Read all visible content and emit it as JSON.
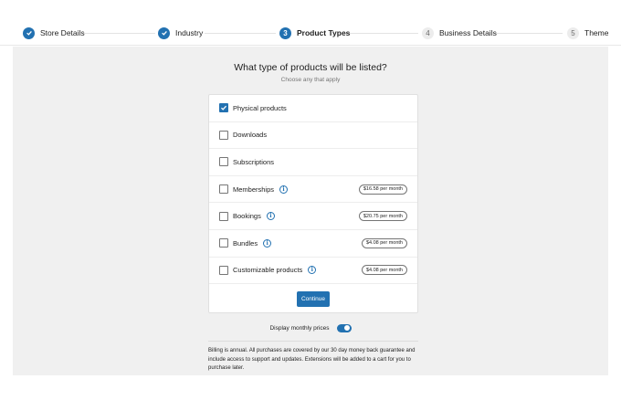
{
  "stepper": {
    "steps": [
      {
        "label": "Store Details",
        "state": "done",
        "badge": "✓"
      },
      {
        "label": "Industry",
        "state": "done",
        "badge": "✓"
      },
      {
        "label": "Product Types",
        "state": "current",
        "badge": "3"
      },
      {
        "label": "Business Details",
        "state": "todo",
        "badge": "4"
      },
      {
        "label": "Theme",
        "state": "todo",
        "badge": "5"
      }
    ]
  },
  "main": {
    "title": "What type of products will be listed?",
    "subtitle": "Choose any that apply",
    "options": [
      {
        "label": "Physical products",
        "checked": true,
        "info": false,
        "price": ""
      },
      {
        "label": "Downloads",
        "checked": false,
        "info": false,
        "price": ""
      },
      {
        "label": "Subscriptions",
        "checked": false,
        "info": false,
        "price": ""
      },
      {
        "label": "Memberships",
        "checked": false,
        "info": true,
        "price": "$16.58 per month"
      },
      {
        "label": "Bookings",
        "checked": false,
        "info": true,
        "price": "$20.75 per month"
      },
      {
        "label": "Bundles",
        "checked": false,
        "info": true,
        "price": "$4.08 per month"
      },
      {
        "label": "Customizable products",
        "checked": false,
        "info": true,
        "price": "$4.08 per month"
      }
    ],
    "continue_label": "Continue",
    "toggle": {
      "label": "Display monthly prices",
      "on": true
    },
    "footnote": "Billing is annual. All purchases are covered by our 30 day money back guarantee and include access to support and updates. Extensions will be added to a cart for you to purchase later."
  },
  "colors": {
    "accent": "#2271b1",
    "background": "#f0f0f0"
  },
  "icons": {
    "check": "check-icon",
    "info": "info-icon"
  }
}
